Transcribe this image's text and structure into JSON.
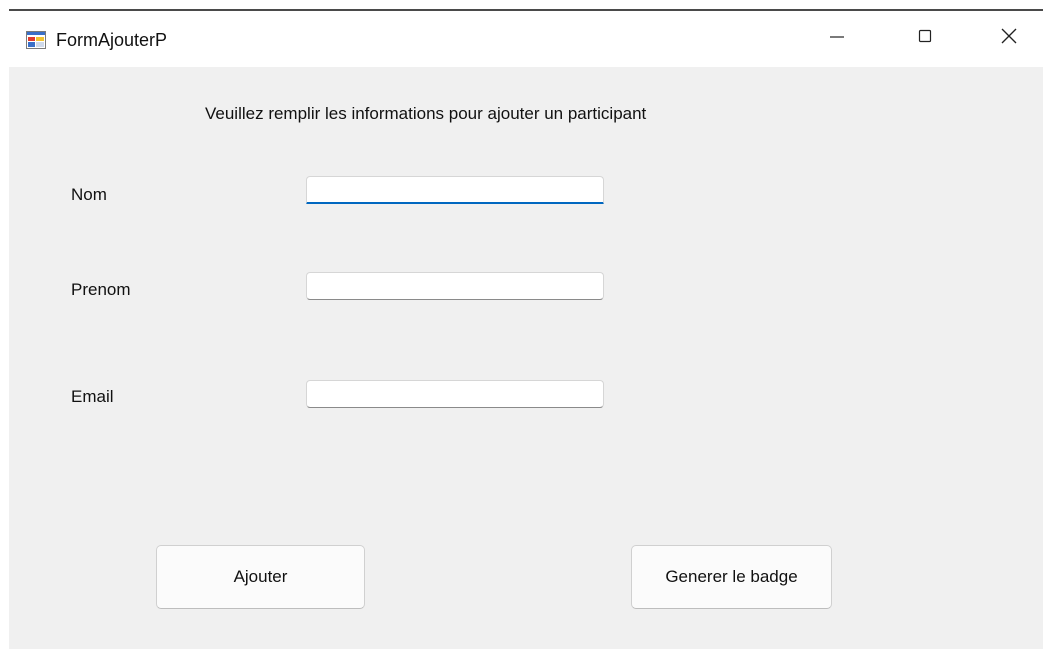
{
  "window": {
    "title": "FormAjouterP"
  },
  "form": {
    "header": "Veuillez remplir les informations pour ajouter un participant",
    "fields": {
      "nom": {
        "label": "Nom",
        "value": ""
      },
      "prenom": {
        "label": "Prenom",
        "value": ""
      },
      "email": {
        "label": "Email",
        "value": ""
      }
    },
    "buttons": {
      "ajouter": "Ajouter",
      "badge": "Generer le badge"
    }
  },
  "icons": {
    "app": "winforms-app-icon",
    "minimize": "minimize-icon",
    "maximize": "maximize-icon",
    "close": "close-icon"
  },
  "colors": {
    "focus_accent": "#0067c0",
    "client_background": "#f0f0f0"
  }
}
